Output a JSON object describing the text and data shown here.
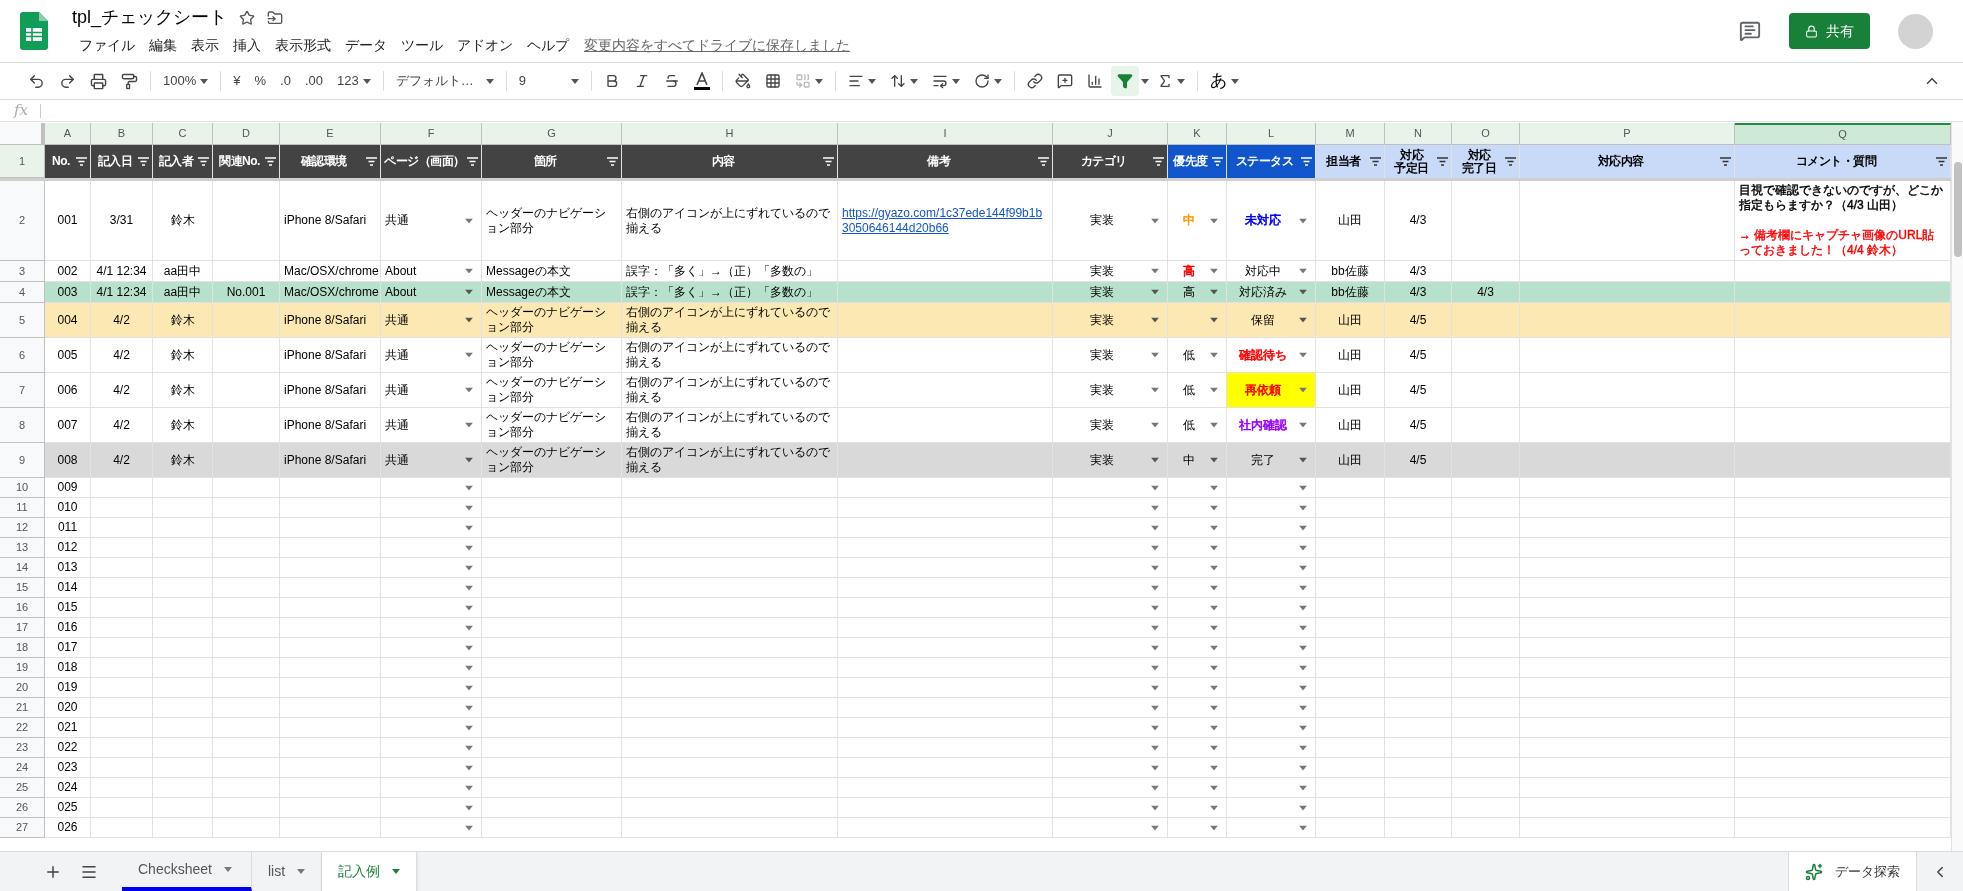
{
  "document": {
    "title": "tpl_チェックシート",
    "saved_status": "変更内容をすべてドライブに保存しました",
    "share": "共有"
  },
  "menu": [
    "ファイル",
    "編集",
    "表示",
    "挿入",
    "表示形式",
    "データ",
    "ツール",
    "アドオン",
    "ヘルプ"
  ],
  "toolbar": {
    "zoom": "100%",
    "currency": "¥",
    "percent": "%",
    "decrease_decimals": ".0",
    "increase_decimals": ".00",
    "format": "123",
    "font": "デフォルト…",
    "font_size": "9",
    "filter_on": true,
    "input_tool": "あ"
  },
  "formula_bar": {
    "label": "fx"
  },
  "columns": [
    {
      "letter": "A",
      "selected": false,
      "dropdown": false
    },
    {
      "letter": "B",
      "selected": false,
      "dropdown": false
    },
    {
      "letter": "C",
      "selected": false,
      "dropdown": false
    },
    {
      "letter": "D",
      "selected": false,
      "dropdown": false
    },
    {
      "letter": "E",
      "selected": false,
      "dropdown": false
    },
    {
      "letter": "F",
      "selected": false,
      "dropdown": true
    },
    {
      "letter": "G",
      "selected": false,
      "dropdown": false
    },
    {
      "letter": "H",
      "selected": false,
      "dropdown": false
    },
    {
      "letter": "I",
      "selected": false,
      "dropdown": false
    },
    {
      "letter": "J",
      "selected": false,
      "dropdown": true
    },
    {
      "letter": "K",
      "selected": false,
      "dropdown": true
    },
    {
      "letter": "L",
      "selected": false,
      "dropdown": true
    },
    {
      "letter": "M",
      "selected": false,
      "dropdown": false
    },
    {
      "letter": "N",
      "selected": false,
      "dropdown": false
    },
    {
      "letter": "O",
      "selected": false,
      "dropdown": false
    },
    {
      "letter": "P",
      "selected": false,
      "dropdown": false
    },
    {
      "letter": "Q",
      "selected": true,
      "dropdown": false
    }
  ],
  "header_row": {
    "number": "1",
    "cells": [
      {
        "lines": [
          "No."
        ]
      },
      {
        "lines": [
          "記入日"
        ]
      },
      {
        "lines": [
          "記入者"
        ]
      },
      {
        "lines": [
          "関連No."
        ]
      },
      {
        "lines": [
          "確認環境"
        ]
      },
      {
        "lines": [
          "ページ（画面）"
        ]
      },
      {
        "lines": [
          "箇所"
        ]
      },
      {
        "lines": [
          "内容"
        ]
      },
      {
        "lines": [
          "備考"
        ]
      },
      {
        "lines": [
          "カテゴリ"
        ]
      },
      {
        "lines": [
          "優先度"
        ]
      },
      {
        "lines": [
          "ステータス"
        ]
      },
      {
        "lines": [
          "担当者"
        ]
      },
      {
        "lines": [
          "対応",
          "予定日"
        ]
      },
      {
        "lines": [
          "対応",
          "完了日"
        ]
      },
      {
        "lines": [
          "対応内容"
        ]
      },
      {
        "lines": [
          "コメント・質問"
        ]
      }
    ]
  },
  "rows": [
    {
      "number": "2",
      "cells": {
        "A": "001",
        "B": "3/31",
        "C": "鈴木",
        "E": "iPhone 8/Safari",
        "F": "共通",
        "G": "ヘッダーのナビゲーション部分",
        "H": "右側のアイコンが上にずれているので揃える",
        "I": {
          "text": "https://gyazo.com/1c37ede144f99b1b3050646144d20b66",
          "kind": "link"
        },
        "J": "実装",
        "K": {
          "text": "中",
          "color": "#ff9900"
        },
        "L": {
          "text": "未対応",
          "color": "#0000ff"
        },
        "M": "山田",
        "N": "4/3",
        "Q": {
          "kind": "comment",
          "lines": [
            {
              "text": "目視で確認できないのですが、どこか指定もらますか？（4/3 山田）",
              "color": "#000000"
            },
            {
              "text": "→ 備考欄にキャプチャ画像のURL貼っておきました！（4/4 鈴木）",
              "color": "#ff0000"
            }
          ]
        }
      }
    },
    {
      "number": "3",
      "cells": {
        "A": "002",
        "B": "4/1 12:34",
        "C": "aa田中",
        "E": "Mac/OSX/chrome",
        "F": "About",
        "G": "Messageの本文",
        "H": "誤字：「多く」→（正）「多数の」",
        "J": "実装",
        "K": {
          "text": "高",
          "color": "#ff0000"
        },
        "L": "対応中",
        "M": "bb佐藤",
        "N": "4/3"
      }
    },
    {
      "number": "4",
      "color": "#b7e1cd",
      "cells": {
        "A": "003",
        "B": "4/1 12:34",
        "C": "aa田中",
        "D": "No.001",
        "E": "Mac/OSX/chrome",
        "F": "About",
        "G": "Messageの本文",
        "H": "誤字：「多く」→（正）「多数の」",
        "J": "実装",
        "K": "高",
        "L": "対応済み",
        "M": "bb佐藤",
        "N": "4/3",
        "O": "4/3"
      }
    },
    {
      "number": "5",
      "color": "#fce8b2",
      "cells": {
        "A": "004",
        "B": "4/2",
        "C": "鈴木",
        "E": "iPhone 8/Safari",
        "F": "共通",
        "G": "ヘッダーのナビゲーション部分",
        "H": "右側のアイコンが上にずれているので揃える",
        "J": "実装",
        "L": "保留",
        "M": "山田",
        "N": "4/5"
      }
    },
    {
      "number": "6",
      "cells": {
        "A": "005",
        "B": "4/2",
        "C": "鈴木",
        "E": "iPhone 8/Safari",
        "F": "共通",
        "G": "ヘッダーのナビゲーション部分",
        "H": "右側のアイコンが上にずれているので揃える",
        "J": "実装",
        "K": "低",
        "L": {
          "text": "確認待ち",
          "color": "#ff0000"
        },
        "M": "山田",
        "N": "4/5"
      }
    },
    {
      "number": "7",
      "cells": {
        "A": "006",
        "B": "4/2",
        "C": "鈴木",
        "E": "iPhone 8/Safari",
        "F": "共通",
        "G": "ヘッダーのナビゲーション部分",
        "H": "右側のアイコンが上にずれているので揃える",
        "J": "実装",
        "K": "低",
        "L": {
          "text": "再依頼",
          "color": "#ff0000",
          "highlight": {
            "color": "#ffff00"
          }
        },
        "M": "山田",
        "N": "4/5"
      }
    },
    {
      "number": "8",
      "cells": {
        "A": "007",
        "B": "4/2",
        "C": "鈴木",
        "E": "iPhone 8/Safari",
        "F": "共通",
        "G": "ヘッダーのナビゲーション部分",
        "H": "右側のアイコンが上にずれているので揃える",
        "J": "実装",
        "K": "低",
        "L": {
          "text": "社内確認",
          "color": "#9900ff"
        },
        "M": "山田",
        "N": "4/5"
      }
    },
    {
      "number": "9",
      "color": "#d9d9d9",
      "cells": {
        "A": "008",
        "B": "4/2",
        "C": "鈴木",
        "E": "iPhone 8/Safari",
        "F": "共通",
        "G": "ヘッダーのナビゲーション部分",
        "H": "右側のアイコンが上にずれているので揃える",
        "J": "実装",
        "K": "中",
        "L": "完了",
        "M": "山田",
        "N": "4/5"
      }
    },
    {
      "number": "10",
      "cells": {
        "A": "009"
      }
    },
    {
      "number": "11",
      "cells": {
        "A": "010"
      }
    },
    {
      "number": "12",
      "cells": {
        "A": "011"
      }
    },
    {
      "number": "13",
      "cells": {
        "A": "012"
      }
    },
    {
      "number": "14",
      "cells": {
        "A": "013"
      }
    },
    {
      "number": "15",
      "cells": {
        "A": "014"
      }
    },
    {
      "number": "16",
      "cells": {
        "A": "015"
      }
    },
    {
      "number": "17",
      "cells": {
        "A": "016"
      }
    },
    {
      "number": "18",
      "cells": {
        "A": "017"
      }
    },
    {
      "number": "19",
      "cells": {
        "A": "018"
      }
    },
    {
      "number": "20",
      "cells": {
        "A": "019"
      }
    },
    {
      "number": "21",
      "cells": {
        "A": "020"
      }
    },
    {
      "number": "22",
      "cells": {
        "A": "021"
      }
    },
    {
      "number": "23",
      "cells": {
        "A": "022"
      }
    },
    {
      "number": "24",
      "cells": {
        "A": "023"
      }
    },
    {
      "number": "25",
      "cells": {
        "A": "024"
      }
    },
    {
      "number": "26",
      "cells": {
        "A": "025"
      }
    },
    {
      "number": "27",
      "cells": {
        "A": "026"
      }
    }
  ],
  "sheet_tabs": [
    {
      "label": "Checksheet",
      "selected": false,
      "underlined": true
    },
    {
      "label": "list",
      "selected": false,
      "underlined": false
    },
    {
      "label": "記入例",
      "selected": true,
      "underlined": false
    }
  ],
  "explore": {
    "label": "データ探索"
  }
}
